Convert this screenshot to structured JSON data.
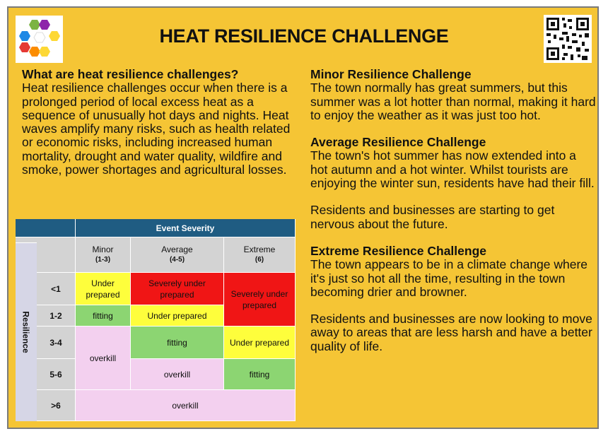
{
  "title": "HEAT RESILIENCE CHALLENGE",
  "logo_icon": "hexagon-cluster-logo",
  "qr_icon": "qr-code",
  "left": {
    "heading": "What are heat resilience challenges?",
    "body": "Heat resilience challenges occur when there is a prolonged period of local excess heat as a sequence of unusually hot days and nights. Heat waves amplify many risks, such as health related or economic risks, including increased human mortality, drought and water quality, wildfire and smoke, power shortages and agricultural losses."
  },
  "right": {
    "minor_heading": "Minor Resilience Challenge",
    "minor_body": "The town normally has great summers, but this summer was a lot hotter than normal, making it hard to enjoy the weather as it was just too hot.",
    "average_heading": "Average Resilience Challenge",
    "average_body": "The town's hot summer has now extended into a hot autumn and a hot winter. Whilst tourists are enjoying the winter sun, residents have had their fill.",
    "average_body2": "Residents and businesses are starting to get nervous about the future.",
    "extreme_heading": "Extreme Resilience Challenge",
    "extreme_body": "The town appears to be in a climate change where it's just so hot all the time, resulting in the town becoming drier and browner.",
    "extreme_body2": "Residents and businesses are now looking to move away to areas that are less harsh and have a better quality of life."
  },
  "table": {
    "severity_header": "Event Severity",
    "resilience_header": "Resilience",
    "columns": [
      {
        "label": "Minor",
        "range": "(1-3)"
      },
      {
        "label": "Average",
        "range": "(4-5)"
      },
      {
        "label": "Extreme",
        "range": "(6)"
      }
    ],
    "rows": [
      "<1",
      "1-2",
      "3-4",
      "5-6",
      ">6"
    ],
    "cells": {
      "r1_minor": "Under prepared",
      "r1_average": "Severely under prepared",
      "r12_extreme": "Severely under prepared",
      "r2_minor": "fitting",
      "r2_average": "Under prepared",
      "r34_minor": "overkill",
      "r3_average": "fitting",
      "r3_extreme": "Under prepared",
      "r4_average": "overkill",
      "r4_extreme": "fitting",
      "r5_all": "overkill"
    },
    "colors": {
      "header": "#1f5c82",
      "under_prepared": "#fefe3c",
      "severely_under_prepared": "#f01515",
      "fitting": "#8cd572",
      "overkill": "#f3d0ef"
    }
  }
}
